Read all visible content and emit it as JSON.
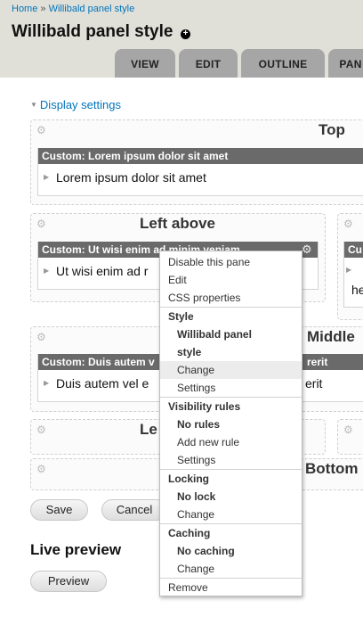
{
  "breadcrumb": {
    "home": "Home",
    "sep": "»",
    "current": "Willibald panel style"
  },
  "page": {
    "title": "Willibald panel style",
    "add_symbol": "+"
  },
  "tabs": [
    {
      "label": "VIEW"
    },
    {
      "label": "EDIT"
    },
    {
      "label": "OUTLINE"
    },
    {
      "label": "PAN"
    }
  ],
  "display_settings": {
    "label": "Display settings"
  },
  "regions": {
    "top": {
      "title": "Top"
    },
    "left_above": {
      "title": "Left above"
    },
    "middle": {
      "title": "Middle"
    },
    "left": {
      "title": "Le"
    },
    "bottom": {
      "title": "Bottom"
    }
  },
  "panes": {
    "top": {
      "title": "Custom: Lorem ipsum dolor sit amet",
      "body": "Lorem ipsum dolor sit amet"
    },
    "left_above": {
      "title": "Custom: Ut wisi enim ad minim veniam",
      "body": "Ut wisi enim ad r"
    },
    "right_above": {
      "title": "Cu",
      "body": "he"
    },
    "middle": {
      "title": "Custom: Duis autem v",
      "title_tail": "rerit",
      "body": "Duis autem vel e",
      "body_tail": "erit"
    }
  },
  "context_menu": {
    "disable": "Disable this pane",
    "edit": "Edit",
    "css": "CSS properties",
    "style_header": "Style",
    "style_value_1": "Willibald panel",
    "style_value_2": "style",
    "style_change": "Change",
    "style_settings": "Settings",
    "visibility_header": "Visibility rules",
    "visibility_value": "No rules",
    "visibility_add": "Add new rule",
    "visibility_settings": "Settings",
    "locking_header": "Locking",
    "locking_value": "No lock",
    "locking_change": "Change",
    "caching_header": "Caching",
    "caching_value": "No caching",
    "caching_change": "Change",
    "remove": "Remove"
  },
  "buttons": {
    "save": "Save",
    "cancel": "Cancel",
    "preview": "Preview"
  },
  "live_preview": {
    "title": "Live preview"
  },
  "icons": {
    "region_gear": "gear-icon",
    "pane_gear": "gear-icon",
    "add": "plus-circle-icon",
    "collapse": "triangle-down-icon",
    "expand": "triangle-right-icon"
  },
  "colors": {
    "link": "#0074bd",
    "header_bg": "#e0e0d8",
    "tab_bg": "#a6a6a6",
    "pane_head": "#6a6a6a",
    "menu_highlight": "#ececec"
  }
}
